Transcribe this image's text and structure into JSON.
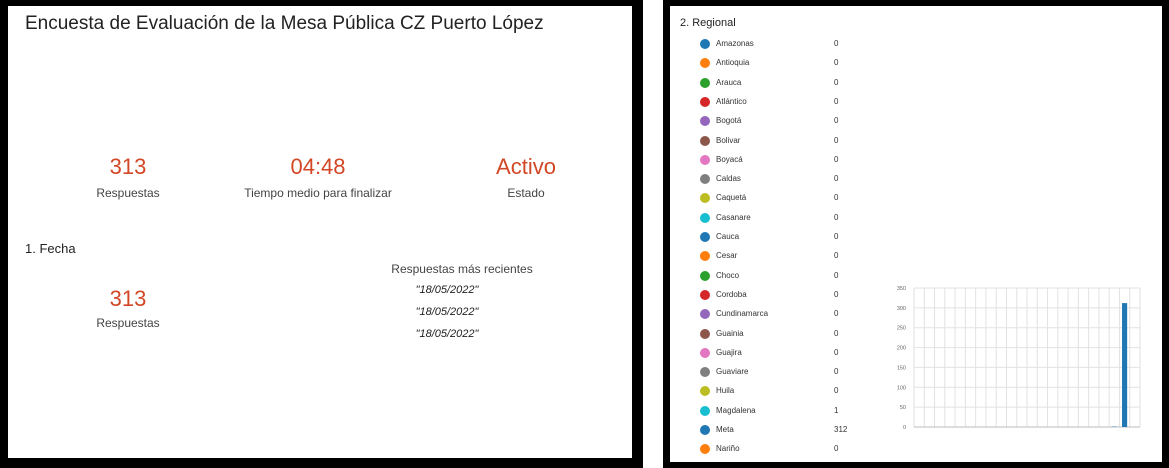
{
  "survey": {
    "title": "Encuesta de Evaluación de la Mesa Pública CZ Puerto López",
    "stats": [
      {
        "value": "313",
        "label": "Respuestas"
      },
      {
        "value": "04:48",
        "label": "Tiempo medio para finalizar"
      },
      {
        "value": "Activo",
        "label": "Estado"
      }
    ],
    "question1": {
      "label": "1.  Fecha",
      "responses_value": "313",
      "responses_label": "Respuestas",
      "recent_title": "Respuestas más recientes",
      "recent": [
        "\"18/05/2022\"",
        "\"18/05/2022\"",
        "\"18/05/2022\""
      ]
    }
  },
  "question2": {
    "label": "2.  Regional",
    "legend": [
      {
        "name": "Amazonas",
        "value": "0",
        "color": "#1f77b4"
      },
      {
        "name": "Antioquia",
        "value": "0",
        "color": "#ff7f0e"
      },
      {
        "name": "Arauca",
        "value": "0",
        "color": "#2ca02c"
      },
      {
        "name": "Atlántico",
        "value": "0",
        "color": "#d62728"
      },
      {
        "name": "Bogotá",
        "value": "0",
        "color": "#9467bd"
      },
      {
        "name": "Bolivar",
        "value": "0",
        "color": "#8c564b"
      },
      {
        "name": "Boyacá",
        "value": "0",
        "color": "#e377c2"
      },
      {
        "name": "Caldas",
        "value": "0",
        "color": "#7f7f7f"
      },
      {
        "name": "Caquetá",
        "value": "0",
        "color": "#bcbd22"
      },
      {
        "name": "Casanare",
        "value": "0",
        "color": "#17becf"
      },
      {
        "name": "Cauca",
        "value": "0",
        "color": "#1f77b4"
      },
      {
        "name": "Cesar",
        "value": "0",
        "color": "#ff7f0e"
      },
      {
        "name": "Choco",
        "value": "0",
        "color": "#2ca02c"
      },
      {
        "name": "Cordoba",
        "value": "0",
        "color": "#d62728"
      },
      {
        "name": "Cundinamarca",
        "value": "0",
        "color": "#9467bd"
      },
      {
        "name": "Guainia",
        "value": "0",
        "color": "#8c564b"
      },
      {
        "name": "Guajira",
        "value": "0",
        "color": "#e377c2"
      },
      {
        "name": "Guaviare",
        "value": "0",
        "color": "#7f7f7f"
      },
      {
        "name": "Huila",
        "value": "0",
        "color": "#bcbd22"
      },
      {
        "name": "Magdalena",
        "value": "1",
        "color": "#17becf"
      },
      {
        "name": "Meta",
        "value": "312",
        "color": "#1f77b4"
      },
      {
        "name": "Nariño",
        "value": "0",
        "color": "#ff7f0e"
      }
    ]
  },
  "chart_data": {
    "type": "bar",
    "categories": [
      "Amazonas",
      "Antioquia",
      "Arauca",
      "Atlántico",
      "Bogotá",
      "Bolivar",
      "Boyacá",
      "Caldas",
      "Caquetá",
      "Casanare",
      "Cauca",
      "Cesar",
      "Choco",
      "Cordoba",
      "Cundinamarca",
      "Guainia",
      "Guajira",
      "Guaviare",
      "Huila",
      "Magdalena",
      "Meta",
      "Nariño"
    ],
    "values": [
      0,
      0,
      0,
      0,
      0,
      0,
      0,
      0,
      0,
      0,
      0,
      0,
      0,
      0,
      0,
      0,
      0,
      0,
      0,
      1,
      312,
      0
    ],
    "yticks": [
      "0",
      "50",
      "100",
      "150",
      "200",
      "250",
      "300",
      "350"
    ],
    "ylim": [
      0,
      350
    ],
    "bar_color": "#1f77b4",
    "grid": true
  }
}
